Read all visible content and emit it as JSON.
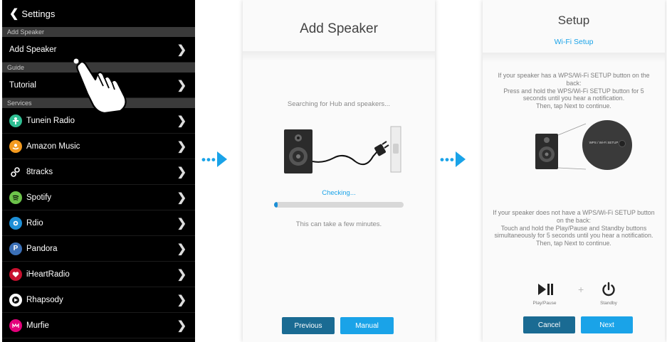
{
  "settings": {
    "back_label": "Settings",
    "sections": {
      "add_speaker": "Add Speaker",
      "guide": "Guide",
      "services": "Services"
    },
    "rows": {
      "add_speaker": "Add Speaker",
      "tutorial": "Tutorial"
    },
    "services": [
      {
        "label": "Tunein Radio",
        "color": "#2fbf93"
      },
      {
        "label": "Amazon Music",
        "color": "#f39a1f"
      },
      {
        "label": "8tracks",
        "color": "#000000"
      },
      {
        "label": "Spotify",
        "color": "#6cc24a"
      },
      {
        "label": "Rdio",
        "color": "#1e8fd6"
      },
      {
        "label": "Pandora",
        "color": "#3b6fb6"
      },
      {
        "label": "iHeartRadio",
        "color": "#c8102e"
      },
      {
        "label": "Rhapsody",
        "color": "#ffffff"
      },
      {
        "label": "Murfie",
        "color": "#e3007b"
      }
    ],
    "pandora_letter": "P"
  },
  "add_speaker_screen": {
    "title": "Add Speaker",
    "searching": "Searching for Hub and speakers...",
    "checking": "Checking...",
    "progress": 0.03,
    "duration_note": "This can take a few minutes.",
    "previous_label": "Previous",
    "manual_label": "Manual",
    "accent": "#1aa3e8",
    "button_dark": "#1a6b93"
  },
  "setup_screen": {
    "title": "Setup",
    "subtitle": "Wi-Fi Setup",
    "wps_text_1": "If your speaker has a WPS/Wi-Fi SETUP button on the back:",
    "wps_text_2": "Press and hold the WPS/Wi-Fi SETUP button for 5 seconds until you hear a notification.",
    "wps_text_3": "Then, tap Next to continue.",
    "wps_badge": "WPS / Wi-Fi SETUP",
    "no_wps_text_1": "If your speaker does not have a WPS/Wi-Fi SETUP button on the back:",
    "no_wps_text_2": "Touch and hold the Play/Pause and Standby buttons simultaneously for 5 seconds until you hear a notification.",
    "no_wps_text_3": "Then, tap Next to continue.",
    "play_pause_label": "Play/Pause",
    "plus": "+",
    "standby_label": "Standby",
    "cancel_label": "Cancel",
    "next_label": "Next"
  }
}
